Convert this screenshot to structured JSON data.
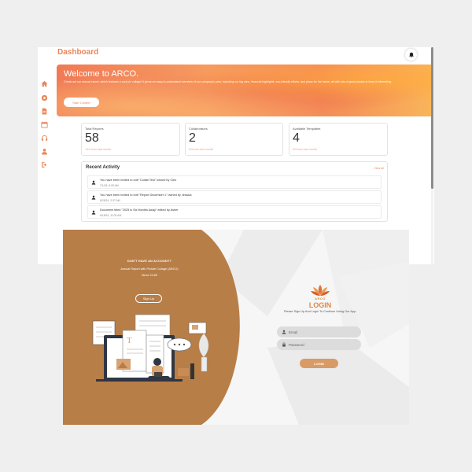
{
  "dashboard": {
    "title": "Dashboard",
    "nav_icons": [
      "home-icon",
      "settings-icon",
      "document-icon",
      "calendar-icon",
      "headphones-icon",
      "user-icon",
      "logout-icon"
    ],
    "hero": {
      "title": "Welcome to ARCO.",
      "text": "Check out our annual report, which features a cool pic collage! It gives an easy-to-understand overview of our company's year, including our big wins, financial highlights, eco-friendly efforts, and plans for the future, all with lots of great photos to keep it interesting.",
      "button": "Start Create!"
    },
    "stats": [
      {
        "label": "Total Reports",
        "value": "58",
        "note": "+5% from last month"
      },
      {
        "label": "Collaborators",
        "value": "2",
        "note": "0% from last month"
      },
      {
        "label": "Available Templates",
        "value": "4",
        "note": "0% from last month"
      }
    ],
    "activity": {
      "title": "Recent Activity",
      "view_all": "View All",
      "items": [
        {
          "text": "You have been invited to edit \"Collab Test\" owned by Cleo",
          "time": "7/1/24, 5:05 AM"
        },
        {
          "text": "You have been invited to edit \"Report December 1\" owned by Jessica",
          "time": "6/25/24, 2:37 AM"
        },
        {
          "text": "Document titled \"2025 is Six Months Away\" edited by Asher",
          "time": "6/18/24, 11:03 AM"
        }
      ]
    }
  },
  "login": {
    "left": {
      "ask": "DON'T HAVE AN ACCOUNT?",
      "report_name": "Annual Report with Pictute Collage (ARCO)",
      "date": "Since 23.80",
      "signup": "Sign Up"
    },
    "brand": "ARCO",
    "title": "LOGIN",
    "subtitle": "Please Sign Up And Login To Continue Using Our App.",
    "email_placeholder": "Email",
    "password_placeholder": "Password",
    "button": "LOGIN"
  },
  "colors": {
    "accent": "#e8875a",
    "brown": "#b87e48",
    "login_button": "#d99b66"
  }
}
